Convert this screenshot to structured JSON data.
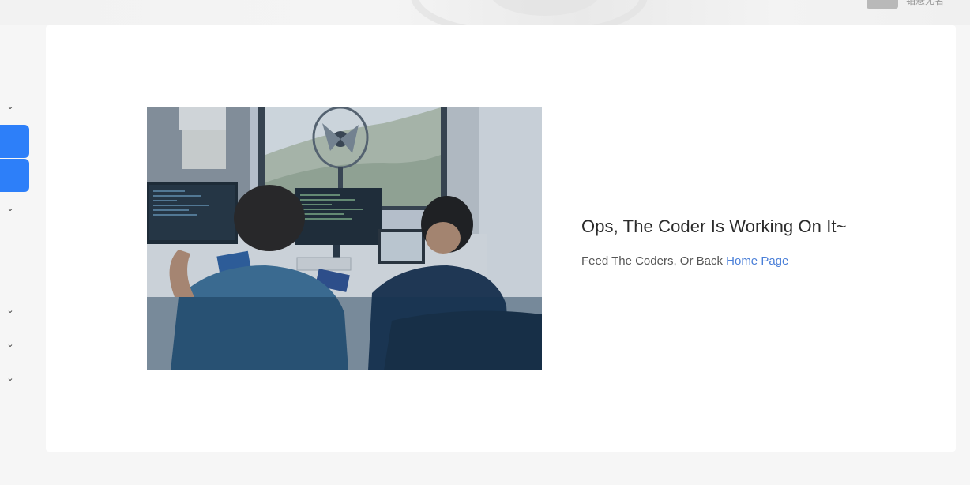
{
  "header": {
    "user_label": "铂悬无名"
  },
  "sidebar": {
    "items": [
      {
        "icon": "chevron-down-icon",
        "active": false
      },
      {
        "icon": "none",
        "active": true
      },
      {
        "icon": "none",
        "active": true
      },
      {
        "icon": "chevron-down-icon",
        "active": false
      },
      {
        "icon": "chevron-down-icon",
        "active": false
      },
      {
        "icon": "chevron-down-icon",
        "active": false
      },
      {
        "icon": "chevron-down-icon",
        "active": false
      }
    ],
    "chevron_glyph": "⌄"
  },
  "main": {
    "headline": "Ops, The Coder Is Working On It~",
    "subline_prefix": "Feed The Coders, Or Back ",
    "home_link": "Home Page"
  },
  "colors": {
    "accent": "#2d7ff9",
    "link": "#4a7fd8"
  }
}
